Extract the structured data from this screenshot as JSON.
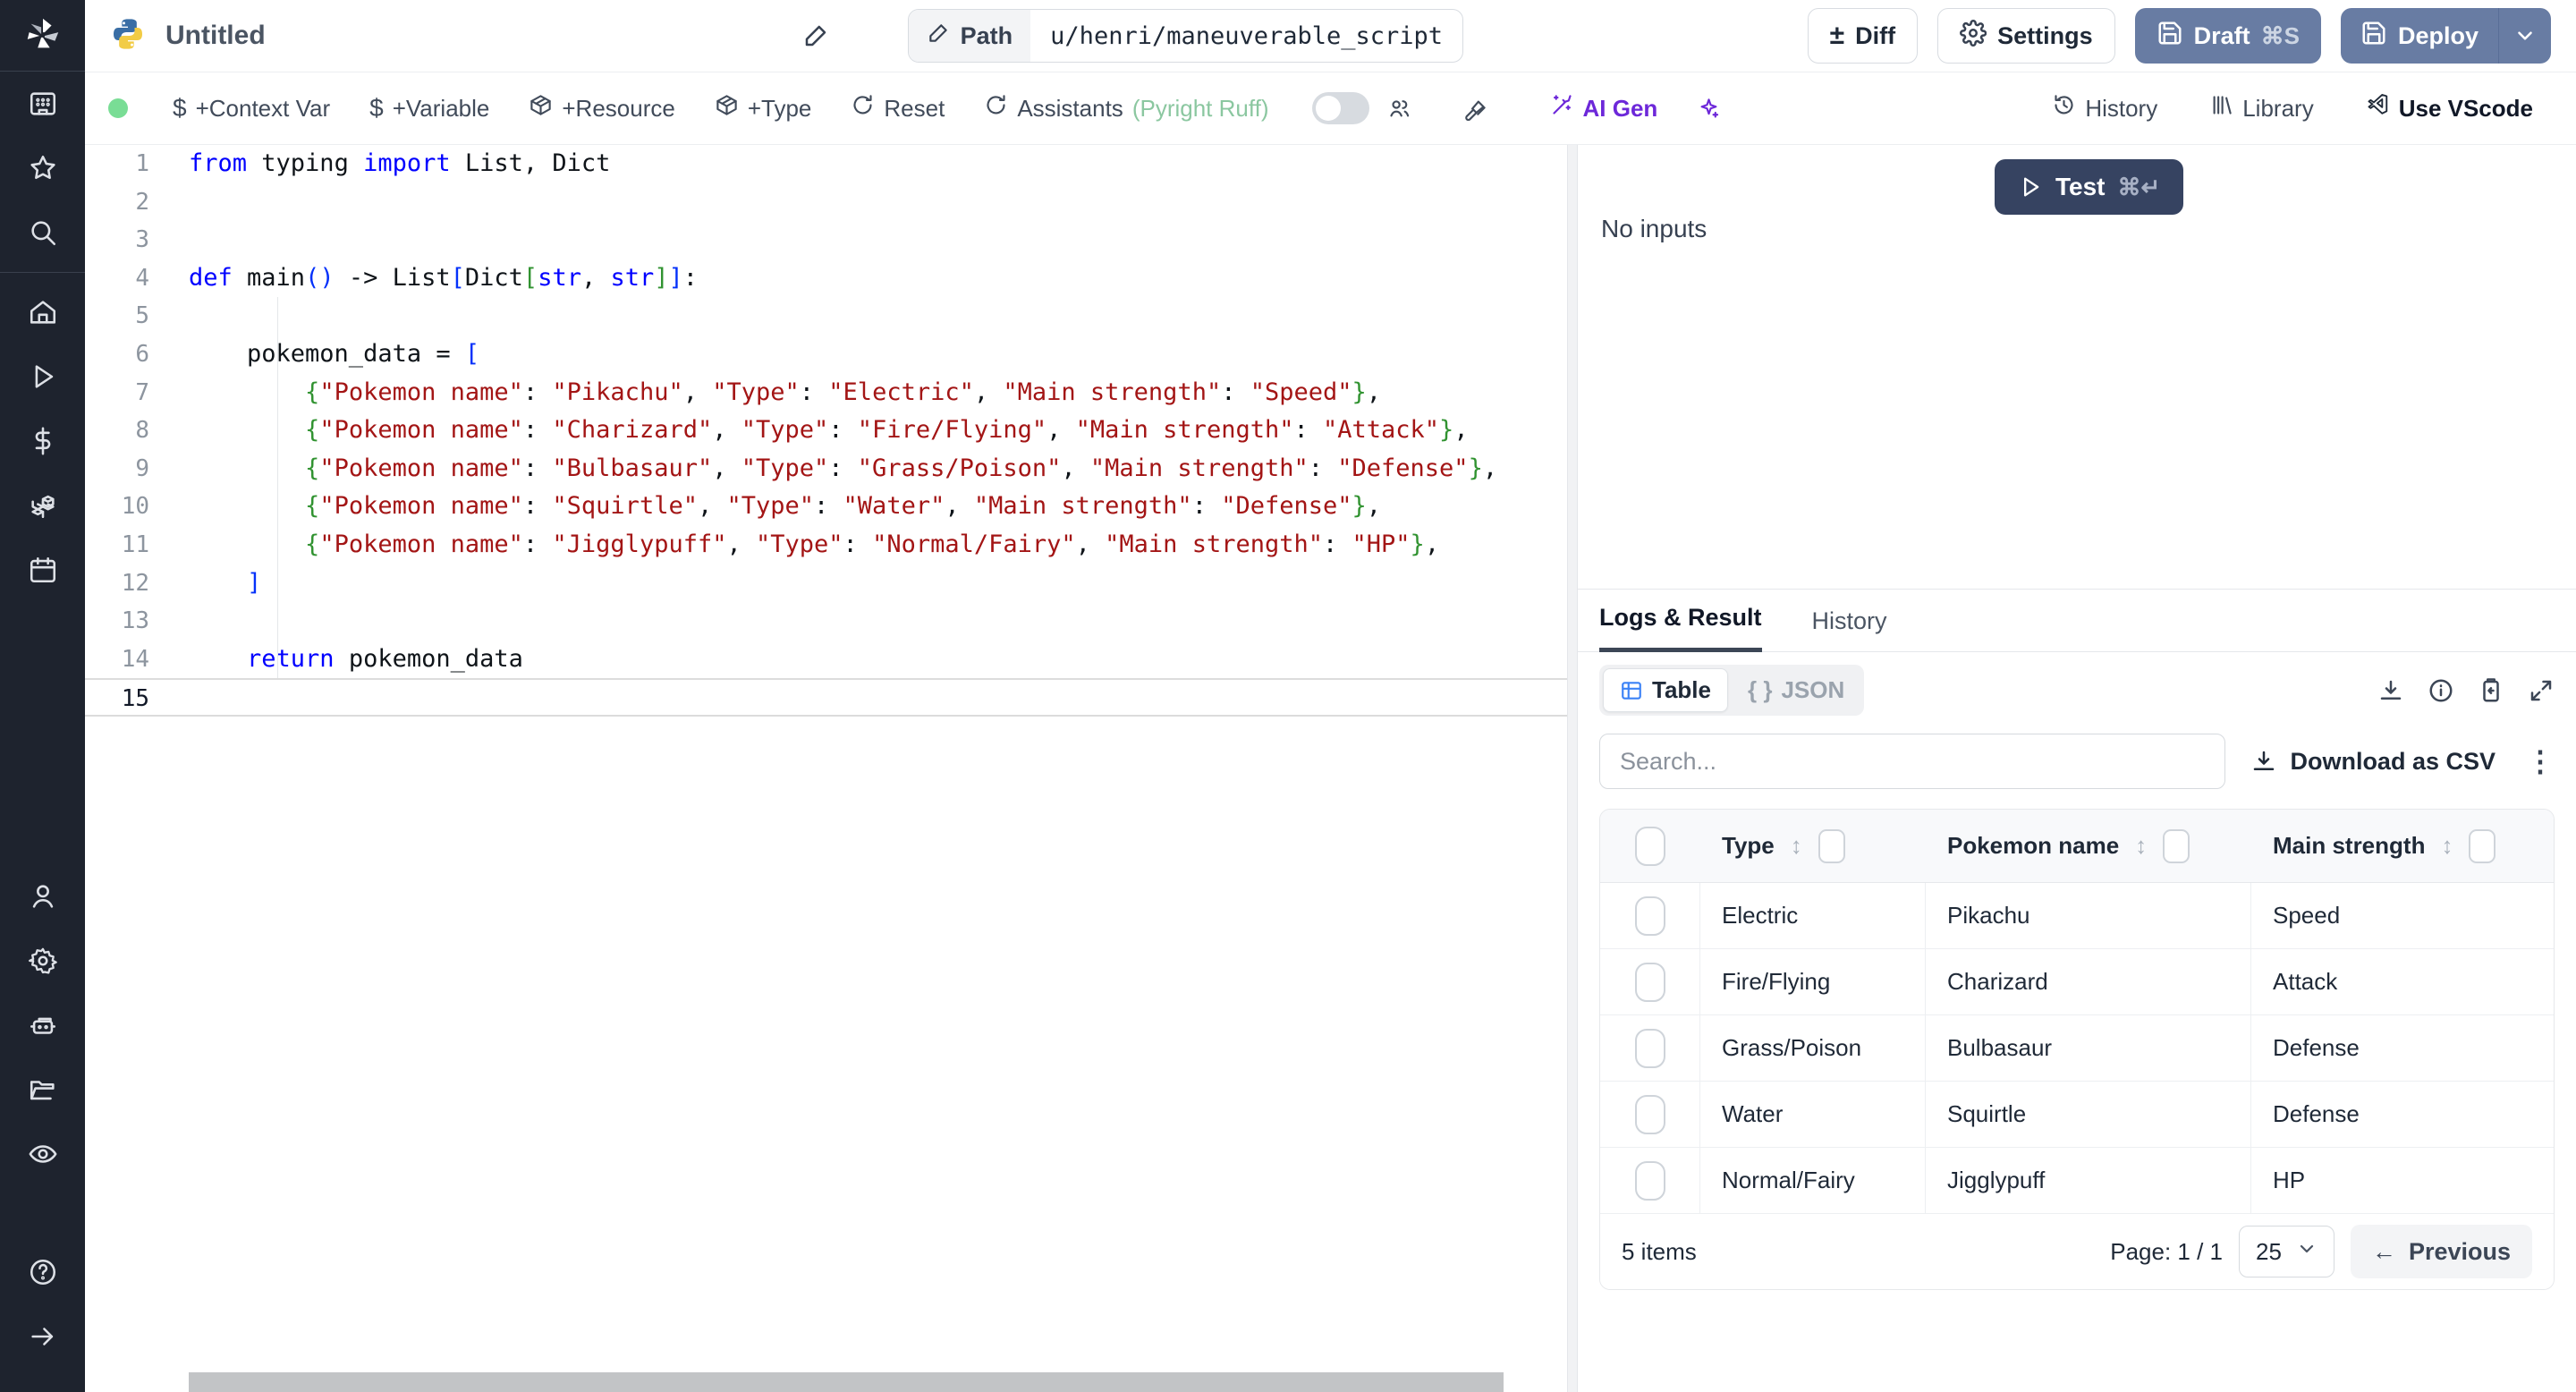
{
  "colors": {
    "accent_slate_button": "#687ca3",
    "test_button": "#364361",
    "ai_purple": "#6d28d9",
    "status_green_dot": "#79dd95",
    "assistants_green": "#8bc7a0",
    "sidebar_bg": "#1e232e",
    "code_keyword": "#0000ff",
    "code_string": "#a31515",
    "code_bracket1": "#0431fa",
    "code_bracket2": "#319331"
  },
  "topbar": {
    "title": "Untitled",
    "path_label": "Path",
    "path_value": "u/henri/maneuverable_script",
    "diff_label": "Diff",
    "settings_label": "Settings",
    "draft_label": "Draft",
    "draft_kbd": "⌘S",
    "deploy_label": "Deploy"
  },
  "toolbar": {
    "context_var": "+Context Var",
    "variable": "+Variable",
    "resource": "+Resource",
    "type": "+Type",
    "reset": "Reset",
    "assistants": "Assistants",
    "assistants_note": "(Pyright Ruff)",
    "ai_gen": "AI Gen",
    "history": "History",
    "library": "Library",
    "use_vscode": "Use VScode"
  },
  "editor": {
    "language": "python",
    "lines": [
      {
        "n": 1,
        "tokens": [
          [
            "kw",
            "from"
          ],
          [
            "t",
            " typing "
          ],
          [
            "kw",
            "import"
          ],
          [
            "t",
            " List, Dict"
          ]
        ]
      },
      {
        "n": 2,
        "tokens": []
      },
      {
        "n": 3,
        "tokens": []
      },
      {
        "n": 4,
        "tokens": [
          [
            "kw",
            "def"
          ],
          [
            "t",
            " main"
          ],
          [
            "b1",
            "()"
          ],
          [
            "t",
            " -> List"
          ],
          [
            "b1",
            "["
          ],
          [
            "t",
            "Dict"
          ],
          [
            "b2",
            "["
          ],
          [
            "kw",
            "str"
          ],
          [
            "t",
            ", "
          ],
          [
            "kw",
            "str"
          ],
          [
            "b2",
            "]"
          ],
          [
            "b1",
            "]"
          ],
          [
            "t",
            ":"
          ]
        ]
      },
      {
        "n": 5,
        "tokens": []
      },
      {
        "n": 6,
        "tokens": [
          [
            "t",
            "    pokemon_data = "
          ],
          [
            "b1",
            "["
          ]
        ]
      },
      {
        "n": 7,
        "tokens": [
          [
            "t",
            "        "
          ],
          [
            "b2",
            "{"
          ],
          [
            "str",
            "\"Pokemon name\""
          ],
          [
            "t",
            ": "
          ],
          [
            "str",
            "\"Pikachu\""
          ],
          [
            "t",
            ", "
          ],
          [
            "str",
            "\"Type\""
          ],
          [
            "t",
            ": "
          ],
          [
            "str",
            "\"Electric\""
          ],
          [
            "t",
            ", "
          ],
          [
            "str",
            "\"Main strength\""
          ],
          [
            "t",
            ": "
          ],
          [
            "str",
            "\"Speed\""
          ],
          [
            "b2",
            "}"
          ],
          [
            "t",
            ","
          ]
        ]
      },
      {
        "n": 8,
        "tokens": [
          [
            "t",
            "        "
          ],
          [
            "b2",
            "{"
          ],
          [
            "str",
            "\"Pokemon name\""
          ],
          [
            "t",
            ": "
          ],
          [
            "str",
            "\"Charizard\""
          ],
          [
            "t",
            ", "
          ],
          [
            "str",
            "\"Type\""
          ],
          [
            "t",
            ": "
          ],
          [
            "str",
            "\"Fire/Flying\""
          ],
          [
            "t",
            ", "
          ],
          [
            "str",
            "\"Main strength\""
          ],
          [
            "t",
            ": "
          ],
          [
            "str",
            "\"Attack\""
          ],
          [
            "b2",
            "}"
          ],
          [
            "t",
            ","
          ]
        ]
      },
      {
        "n": 9,
        "tokens": [
          [
            "t",
            "        "
          ],
          [
            "b2",
            "{"
          ],
          [
            "str",
            "\"Pokemon name\""
          ],
          [
            "t",
            ": "
          ],
          [
            "str",
            "\"Bulbasaur\""
          ],
          [
            "t",
            ", "
          ],
          [
            "str",
            "\"Type\""
          ],
          [
            "t",
            ": "
          ],
          [
            "str",
            "\"Grass/Poison\""
          ],
          [
            "t",
            ", "
          ],
          [
            "str",
            "\"Main strength\""
          ],
          [
            "t",
            ": "
          ],
          [
            "str",
            "\"Defense\""
          ],
          [
            "b2",
            "}"
          ],
          [
            "t",
            ","
          ]
        ]
      },
      {
        "n": 10,
        "tokens": [
          [
            "t",
            "        "
          ],
          [
            "b2",
            "{"
          ],
          [
            "str",
            "\"Pokemon name\""
          ],
          [
            "t",
            ": "
          ],
          [
            "str",
            "\"Squirtle\""
          ],
          [
            "t",
            ", "
          ],
          [
            "str",
            "\"Type\""
          ],
          [
            "t",
            ": "
          ],
          [
            "str",
            "\"Water\""
          ],
          [
            "t",
            ", "
          ],
          [
            "str",
            "\"Main strength\""
          ],
          [
            "t",
            ": "
          ],
          [
            "str",
            "\"Defense\""
          ],
          [
            "b2",
            "}"
          ],
          [
            "t",
            ","
          ]
        ]
      },
      {
        "n": 11,
        "tokens": [
          [
            "t",
            "        "
          ],
          [
            "b2",
            "{"
          ],
          [
            "str",
            "\"Pokemon name\""
          ],
          [
            "t",
            ": "
          ],
          [
            "str",
            "\"Jigglypuff\""
          ],
          [
            "t",
            ", "
          ],
          [
            "str",
            "\"Type\""
          ],
          [
            "t",
            ": "
          ],
          [
            "str",
            "\"Normal/Fairy\""
          ],
          [
            "t",
            ", "
          ],
          [
            "str",
            "\"Main strength\""
          ],
          [
            "t",
            ": "
          ],
          [
            "str",
            "\"HP\""
          ],
          [
            "b2",
            "}"
          ],
          [
            "t",
            ","
          ]
        ]
      },
      {
        "n": 12,
        "tokens": [
          [
            "t",
            "    "
          ],
          [
            "b1",
            "]"
          ]
        ]
      },
      {
        "n": 13,
        "tokens": []
      },
      {
        "n": 14,
        "tokens": [
          [
            "t",
            "    "
          ],
          [
            "kw",
            "return"
          ],
          [
            "t",
            " pokemon_data"
          ]
        ]
      },
      {
        "n": 15,
        "tokens": [],
        "active": true
      }
    ]
  },
  "runner": {
    "test_label": "Test",
    "test_kbd": "⌘↵",
    "no_inputs": "No inputs"
  },
  "results": {
    "tabs": [
      {
        "label": "Logs & Result",
        "active": true
      },
      {
        "label": "History",
        "active": false
      }
    ],
    "view_toggle": [
      {
        "label": "Table",
        "active": true
      },
      {
        "label": "JSON",
        "active": false,
        "prefix": "{ }"
      }
    ],
    "search_placeholder": "Search...",
    "download_csv_label": "Download as CSV",
    "table": {
      "columns": [
        "Type",
        "Pokemon name",
        "Main strength"
      ],
      "rows": [
        {
          "type": "Electric",
          "name": "Pikachu",
          "strength": "Speed"
        },
        {
          "type": "Fire/Flying",
          "name": "Charizard",
          "strength": "Attack"
        },
        {
          "type": "Grass/Poison",
          "name": "Bulbasaur",
          "strength": "Defense"
        },
        {
          "type": "Water",
          "name": "Squirtle",
          "strength": "Defense"
        },
        {
          "type": "Normal/Fairy",
          "name": "Jigglypuff",
          "strength": "HP"
        }
      ],
      "items_count": "5 items",
      "page_label": "Page: 1 / 1",
      "page_size": "25",
      "previous_label": "Previous"
    }
  }
}
